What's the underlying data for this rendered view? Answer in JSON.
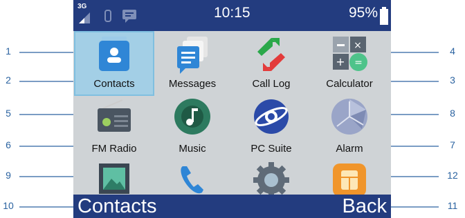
{
  "status_bar": {
    "network": "3G",
    "time": "10:15",
    "battery": "95%",
    "icons": [
      "signal-icon",
      "bluetooth-icon",
      "message-icon",
      "battery-icon"
    ]
  },
  "apps": [
    {
      "label": "Contacts",
      "icon": "contacts-icon",
      "selected": true
    },
    {
      "label": "Messages",
      "icon": "messages-icon"
    },
    {
      "label": "Call Log",
      "icon": "call-log-icon"
    },
    {
      "label": "Calculator",
      "icon": "calculator-icon"
    },
    {
      "label": "FM Radio",
      "icon": "radio-icon"
    },
    {
      "label": "Music",
      "icon": "music-icon"
    },
    {
      "label": "PC Suite",
      "icon": "pc-suite-icon"
    },
    {
      "label": "Alarm",
      "icon": "alarm-icon"
    },
    {
      "label": "",
      "icon": "gallery-icon"
    },
    {
      "label": "",
      "icon": "phone-icon"
    },
    {
      "label": "",
      "icon": "settings-icon"
    },
    {
      "label": "",
      "icon": "sim-icon"
    }
  ],
  "softkeys": {
    "left": "Contacts",
    "right": "Back"
  },
  "callouts": [
    "1",
    "2",
    "3",
    "4",
    "5",
    "6",
    "7",
    "8",
    "9",
    "10",
    "11",
    "12"
  ],
  "colors": {
    "bar": "#233c7f",
    "screen": "#cfd3d6",
    "selected": "#a3cfe6",
    "callout": "#2a62a0"
  }
}
